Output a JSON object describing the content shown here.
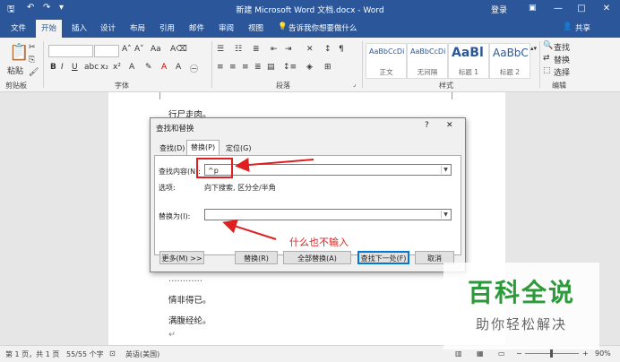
{
  "titlebar": {
    "document_title": "新建 Microsoft Word 文档.docx - Word",
    "login": "登录",
    "minimize": "—",
    "restore": "□",
    "close": "✕"
  },
  "ribbon_tabs": {
    "file": "文件",
    "home": "开始",
    "insert": "插入",
    "design": "设计",
    "layout": "布局",
    "references": "引用",
    "mailings": "邮件",
    "review": "审阅",
    "view": "视图",
    "tell_me": "告诉我你想要做什么",
    "share": "共享"
  },
  "ribbon": {
    "paste": "粘贴",
    "clipboard": "剪贴板",
    "font": "字体",
    "paragraph": "段落",
    "styles": "样式",
    "editing": "编辑",
    "find": "查找",
    "replace": "替换",
    "select": "选择",
    "style_items": [
      {
        "preview": "AaBbCcDi",
        "name": "正文"
      },
      {
        "preview": "AaBbCcDi",
        "name": "无间隔"
      },
      {
        "preview": "AaBl",
        "name": "标题 1"
      },
      {
        "preview": "AaBbC",
        "name": "标题 2"
      }
    ]
  },
  "document": {
    "lines": [
      "行尸走肉。",
      "情非得已。",
      "满腹经纶。"
    ],
    "partial_line": "…………"
  },
  "dialog": {
    "title": "查找和替换",
    "help": "?",
    "close": "✕",
    "tabs": {
      "find": "查找(D)",
      "replace": "替换(P)",
      "goto": "定位(G)"
    },
    "find_label": "查找内容(N):",
    "find_value": "^p",
    "options_label": "选项:",
    "options_value": "向下搜索, 区分全/半角",
    "replace_label": "替换为(I):",
    "replace_value": "",
    "buttons": {
      "more": "更多(M) >>",
      "replace": "替换(R)",
      "replace_all": "全部替换(A)",
      "find_next": "查找下一处(F)",
      "cancel": "取消"
    }
  },
  "annotation": {
    "text": "什么也不输入",
    "color": "#e02020"
  },
  "statusbar": {
    "page": "第 1 页，共 1 页",
    "words": "55/55 个字",
    "lang": "英语(美国)",
    "zoom": "90%"
  },
  "watermark": {
    "main": "百科全说",
    "sub": "助你轻松解决"
  },
  "colors": {
    "brand": "#2b579a",
    "annotation_red": "#e02020",
    "watermark_green": "#2c9a3a"
  }
}
